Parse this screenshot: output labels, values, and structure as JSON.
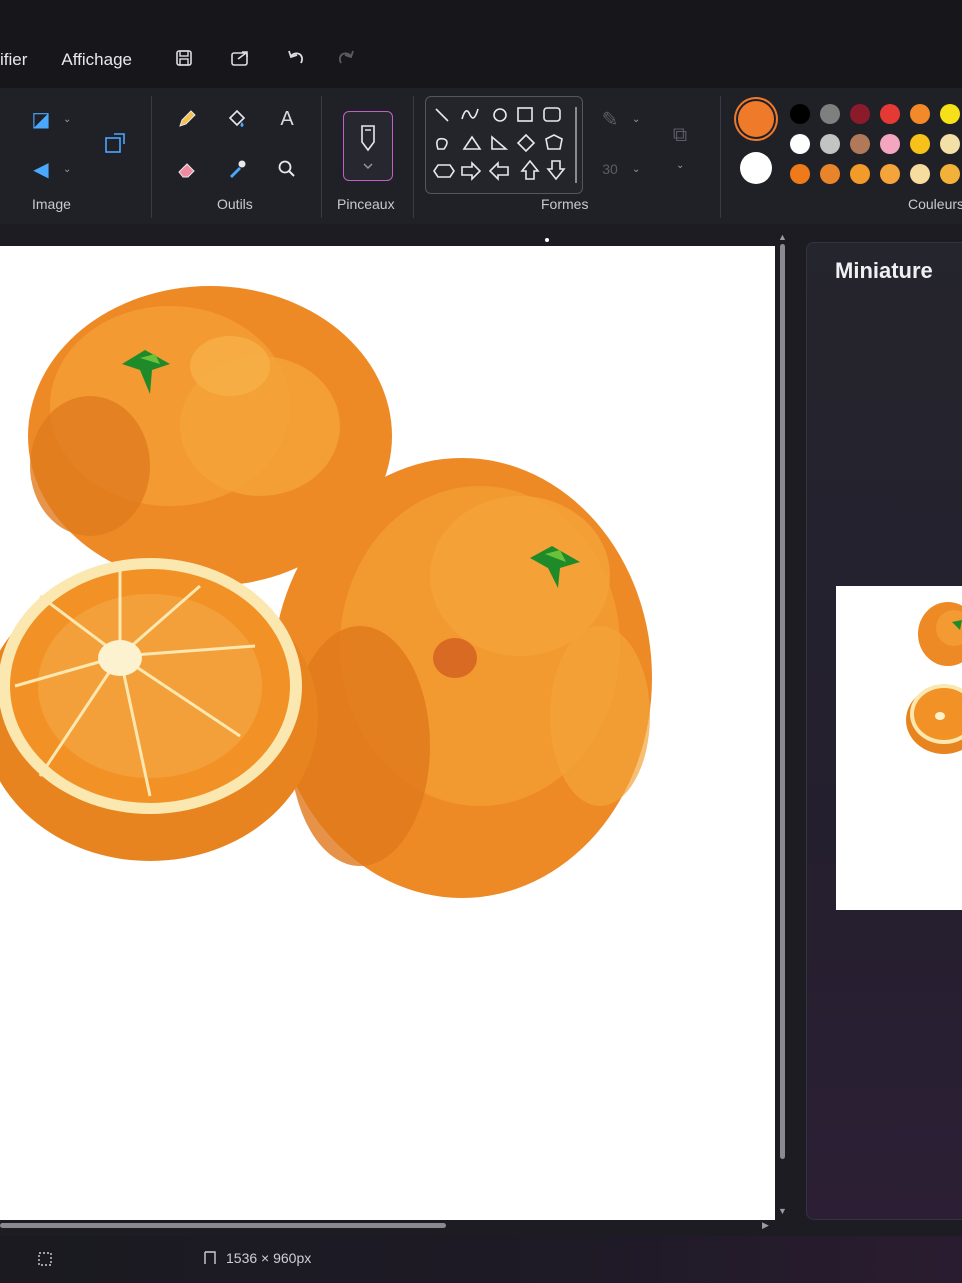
{
  "menu": {
    "items": [
      "ifier",
      "Affichage"
    ]
  },
  "quick_access": {
    "icons": [
      "save-icon",
      "share-icon",
      "undo-icon",
      "redo-icon"
    ]
  },
  "ribbon": {
    "groups": {
      "image": "Image",
      "tools": "Outils",
      "brushes": "Pinceaux",
      "shapes": "Formes",
      "colors": "Couleurs"
    },
    "stroke_size_label": "30"
  },
  "colors": {
    "primary": "#ee7a2a",
    "secondary": "#ffffff",
    "palette_row1": [
      "#000000",
      "#7f7f7f",
      "#8b1a2a",
      "#e53935",
      "#f28a2a",
      "#f6e01a"
    ],
    "palette_row2": [
      "#ffffff",
      "#c3c3c3",
      "#b07a5a",
      "#f4a6c0",
      "#f6c21a",
      "#f2e0a6"
    ],
    "palette_row3": [
      "#ee7a1a",
      "#e8842a",
      "#f29a2a",
      "#f4a43a",
      "#f7dca0",
      "#f2b23a"
    ]
  },
  "thumbnail": {
    "title": "Miniature"
  },
  "status": {
    "dimensions": "1536 × 960px"
  }
}
